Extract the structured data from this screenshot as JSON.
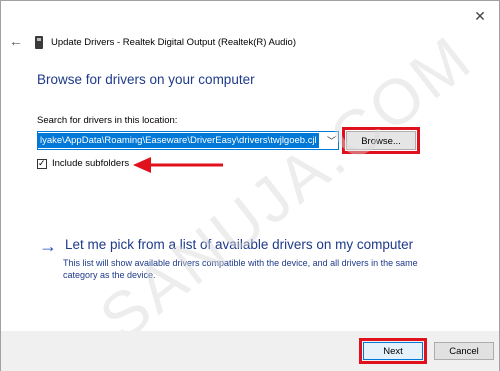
{
  "window": {
    "title": "Update Drivers - Realtek Digital Output (Realtek(R) Audio)"
  },
  "heading": "Browse for drivers on your computer",
  "search": {
    "label": "Search for drivers in this location:",
    "path_value": "lyake\\AppData\\Roaming\\Easeware\\DriverEasy\\drivers\\twjlgoeb.cjl",
    "browse_label": "Browse..."
  },
  "include_subfolders": {
    "label": "Include subfolders",
    "checked": true
  },
  "pick_option": {
    "title": "Let me pick from a list of available drivers on my computer",
    "description": "This list will show available drivers compatible with the device, and all drivers in the same category as the device."
  },
  "footer": {
    "next_label": "Next",
    "cancel_label": "Cancel"
  },
  "watermark": "SANUJA.COM",
  "colors": {
    "accent": "#0078d7",
    "highlight": "#e0101c",
    "link": "#1e3a8a"
  }
}
